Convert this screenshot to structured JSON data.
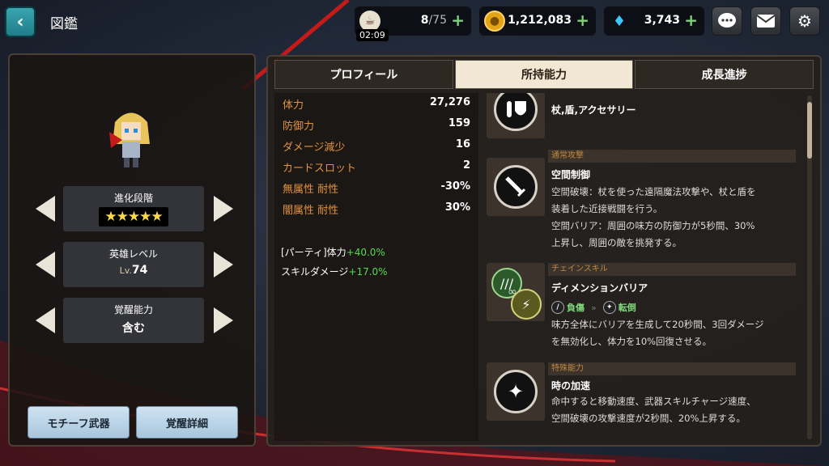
{
  "header": {
    "title": "図鑑",
    "stamina": {
      "current": "8",
      "max": "/75",
      "timer": "02:09"
    },
    "gold": "1,212,083",
    "gems": "3,743"
  },
  "character": {
    "stats": [
      {
        "label": "進化段階",
        "value": "★★★★★"
      },
      {
        "label": "英雄レベル",
        "prefix": "Lv.",
        "value": "74"
      },
      {
        "label": "覚醒能力",
        "value": "含む"
      }
    ],
    "buttons": {
      "motif_weapon": "モチーフ武器",
      "awakening_detail": "覚醒詳細"
    }
  },
  "tabs": [
    {
      "label": "プロフィール",
      "active": false
    },
    {
      "label": "所持能力",
      "active": true
    },
    {
      "label": "成長進捗",
      "active": false
    }
  ],
  "stats": [
    {
      "name": "体力",
      "value": "27,276"
    },
    {
      "name": "防御力",
      "value": "159"
    },
    {
      "name": "ダメージ減少",
      "value": "16"
    },
    {
      "name": "カードスロット",
      "value": "2"
    },
    {
      "name": "無属性 耐性",
      "value": "-30%"
    },
    {
      "name": "闇属性 耐性",
      "value": "30%"
    }
  ],
  "bonuses": [
    {
      "label": "[パーティ]体力",
      "value": "+40.0%"
    },
    {
      "label": "スキルダメージ",
      "value": "+17.0%"
    }
  ],
  "skills": {
    "equip": {
      "text": "杖,盾,アクセサリー"
    },
    "normal": {
      "category": "通常攻撃",
      "name": "空間制御",
      "desc": [
        "空間破壊：杖を使った遠隔魔法攻撃や、杖と盾を",
        "装着した近接戦闘を行う。",
        "空間バリア：周囲の味方の防御力が5秒間、30%",
        "上昇し、周囲の敵を挑発する。"
      ]
    },
    "chain": {
      "category": "チェインスキル",
      "name": "ディメンションバリア",
      "tag_from": "負傷",
      "tag_to": "転倒",
      "desc": [
        "味方全体にバリアを生成して20秒間、3回ダメージ",
        "を無効化し、体力を10%回復させる。"
      ]
    },
    "special": {
      "category": "特殊能力",
      "name": "時の加速",
      "desc": [
        "命中すると移動速度、武器スキルチャージ速度、",
        "空間破壊の攻撃速度が2秒間、20%上昇する。"
      ]
    }
  },
  "colors": {
    "accent": "#e2923c",
    "bonus": "#56d94e",
    "tab_active": "#f2e7d2"
  }
}
